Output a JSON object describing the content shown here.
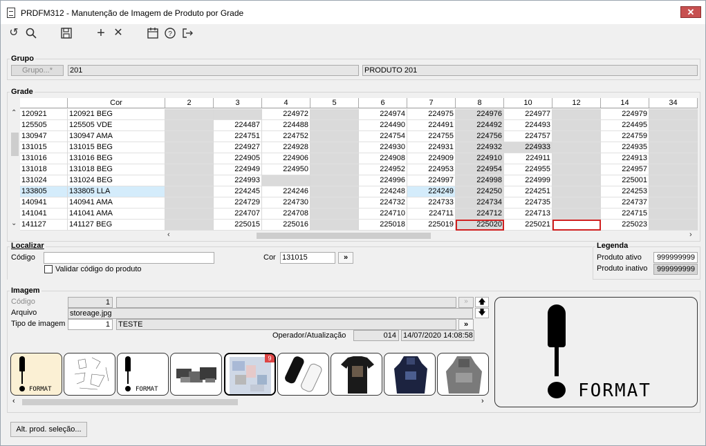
{
  "window": {
    "title": "PRDFM312 - Manutenção de Imagem de Produto por Grade",
    "close_label": "✕"
  },
  "toolbar": {
    "undo": "↺",
    "search": "🔍",
    "save": "💾",
    "add": "+",
    "delete": "✕",
    "calendar": "📅",
    "help": "?",
    "exit": "⇥"
  },
  "grupo": {
    "section_label": "Grupo",
    "button_label": "Grupo...*",
    "code": "201",
    "description": "PRODUTO 201"
  },
  "grade": {
    "section_label": "Grade",
    "columns": [
      "",
      "Cor",
      "2",
      "3",
      "4",
      "5",
      "6",
      "7",
      "8",
      "10",
      "12",
      "14",
      "34"
    ],
    "rows": [
      {
        "code": "120921",
        "cor": "120921 BEG",
        "cells": [
          "",
          "",
          "224972",
          "",
          "224974",
          "224975",
          "224976",
          "224977",
          "",
          "224979",
          ""
        ]
      },
      {
        "code": "125505",
        "cor": "125505 VDE",
        "cells": [
          "",
          "224487",
          "224488",
          "",
          "224490",
          "224491",
          "224492",
          "224493",
          "",
          "224495",
          ""
        ]
      },
      {
        "code": "130947",
        "cor": "130947 AMA",
        "cells": [
          "",
          "224751",
          "224752",
          "",
          "224754",
          "224755",
          "224756",
          "224757",
          "",
          "224759",
          ""
        ]
      },
      {
        "code": "131015",
        "cor": "131015 BEG",
        "cells": [
          "",
          "224927",
          "224928",
          "",
          "224930",
          "224931",
          "224932",
          "224933",
          "",
          "224935",
          ""
        ]
      },
      {
        "code": "131016",
        "cor": "131016 BEG",
        "cells": [
          "",
          "224905",
          "224906",
          "",
          "224908",
          "224909",
          "224910",
          "224911",
          "",
          "224913",
          ""
        ]
      },
      {
        "code": "131018",
        "cor": "131018 BEG",
        "cells": [
          "",
          "224949",
          "224950",
          "",
          "224952",
          "224953",
          "224954",
          "224955",
          "",
          "224957",
          ""
        ]
      },
      {
        "code": "131024",
        "cor": "131024 BEG",
        "cells": [
          "",
          "224993",
          "",
          "",
          "224996",
          "224997",
          "224998",
          "224999",
          "",
          "225001",
          ""
        ]
      },
      {
        "code": "133805",
        "cor": "133805 LLA",
        "cells": [
          "",
          "224245",
          "224246",
          "",
          "224248",
          "224249",
          "224250",
          "224251",
          "",
          "224253",
          ""
        ]
      },
      {
        "code": "140941",
        "cor": "140941 AMA",
        "cells": [
          "",
          "224729",
          "224730",
          "",
          "224732",
          "224733",
          "224734",
          "224735",
          "",
          "224737",
          ""
        ]
      },
      {
        "code": "141041",
        "cor": "141041 AMA",
        "cells": [
          "",
          "224707",
          "224708",
          "",
          "224710",
          "224711",
          "224712",
          "224713",
          "",
          "224715",
          ""
        ]
      },
      {
        "code": "141127",
        "cor": "141127 BEG",
        "cells": [
          "",
          "225015",
          "225016",
          "",
          "225018",
          "225019",
          "225020",
          "225021",
          "",
          "225023",
          ""
        ]
      }
    ]
  },
  "localizar": {
    "section_label": "Localizar",
    "codigo_label": "Código",
    "codigo_value": "",
    "cor_label": "Cor",
    "cor_value": "131015",
    "go_label": "»",
    "validar_label": "Validar código do produto"
  },
  "legenda": {
    "section_label": "Legenda",
    "ativo_label": "Produto ativo",
    "ativo_value": "999999999",
    "inativo_label": "Produto inativo",
    "inativo_value": "999999999"
  },
  "imagem": {
    "section_label": "Imagem",
    "codigo_label": "Código",
    "codigo_value": "1",
    "arquivo_label": "Arquivo",
    "arquivo_value": "storeage.jpg",
    "tipo_label": "Tipo de imagem",
    "tipo_value": "1",
    "tipo_desc": "TESTE",
    "operador_label": "Operador/Atualização",
    "operador_value": "014",
    "data_value": "14/07/2020 14:08:58",
    "preview_text": "FORMAT",
    "thumb_text": "FORMAT",
    "thumb_badge": "9"
  },
  "footer": {
    "alt_button": "Alt. prod. seleção..."
  },
  "colors": {
    "accent_red": "#d02020",
    "selection": "#d4ecfb",
    "gray_cell": "#dadada",
    "close": "#c75050"
  }
}
